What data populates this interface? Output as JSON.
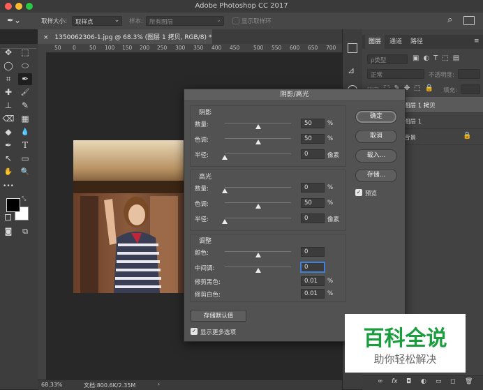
{
  "app": {
    "title": "Adobe Photoshop CC 2017"
  },
  "options_bar": {
    "sample_size_label": "取样大小:",
    "sample_size_value": "取样点",
    "sample_label": "样本:",
    "sample_value": "所有图层",
    "sample_ring_label": "显示取样环"
  },
  "document_tab": {
    "title": "1350062306-1.jpg @ 68.3% (图层 1 拷贝, RGB/8) *",
    "close": "×"
  },
  "ruler": {
    "ticks": [
      "50",
      "0",
      "50",
      "100",
      "150",
      "200",
      "250",
      "300",
      "350",
      "400",
      "450",
      "500",
      "550",
      "600",
      "650",
      "700"
    ]
  },
  "status": {
    "zoom": "68.33%",
    "doc": "文档:800.6K/2.35M",
    "arrow": "›"
  },
  "toolbar": {
    "glyphs": [
      "✥",
      "⬚",
      "◯",
      "⬭",
      "⌗",
      "✒",
      "✚",
      "🖌",
      "⊥",
      "✎",
      "⌫",
      "▦",
      "◆",
      "💧",
      "✒",
      "T",
      "↖",
      "▭",
      "✋",
      "🔍",
      "•••"
    ]
  },
  "layers_panel": {
    "tabs": [
      "图层",
      "通道",
      "路径"
    ],
    "kind_label": "ρ类型",
    "blend_mode": "正常",
    "opacity_label": "不透明度:",
    "lock_label": "锁定:",
    "fill_label": "填充:",
    "layers": [
      {
        "name": "图层 1 拷贝",
        "locked": false
      },
      {
        "name": "图层 1",
        "locked": false
      },
      {
        "name": "背景",
        "locked": true
      }
    ],
    "bottom_icons": [
      "∞",
      "fx",
      "◘",
      "◐",
      "▭",
      "◻",
      "🗑"
    ]
  },
  "dialog": {
    "title": "阴影/高光",
    "shadows": {
      "title": "阴影",
      "rows": [
        {
          "label": "数量:",
          "value": "50",
          "unit": "%",
          "level": 0.5
        },
        {
          "label": "色调:",
          "value": "50",
          "unit": "%",
          "level": 0.5
        },
        {
          "label": "半径:",
          "value": "0",
          "unit": "像素",
          "level": 0.0
        }
      ]
    },
    "highlights": {
      "title": "高光",
      "rows": [
        {
          "label": "数量:",
          "value": "0",
          "unit": "%",
          "level": 0.0
        },
        {
          "label": "色调:",
          "value": "50",
          "unit": "%",
          "level": 0.5
        },
        {
          "label": "半径:",
          "value": "0",
          "unit": "像素",
          "level": 0.0
        }
      ]
    },
    "adjust": {
      "title": "调整",
      "rows": [
        {
          "label": "颜色:",
          "value": "0",
          "unit": "",
          "level": 0.5
        },
        {
          "label": "中间调:",
          "value": "0",
          "unit": "",
          "level": 0.5
        },
        {
          "label": "修剪黑色:",
          "value": "0.01",
          "unit": "%"
        },
        {
          "label": "修剪白色:",
          "value": "0.01",
          "unit": "%"
        }
      ]
    },
    "buttons": {
      "ok": "确定",
      "cancel": "取消",
      "load": "载入...",
      "save": "存储..."
    },
    "preview_label": "预览",
    "save_defaults_label": "存储默认值",
    "show_more_label": "显示更多选项"
  },
  "watermark": {
    "title": "百科全说",
    "subtitle": "助你轻松解决"
  },
  "colors": {
    "accent": "#2f6fd0",
    "watermark_green": "#1a9d3c"
  }
}
